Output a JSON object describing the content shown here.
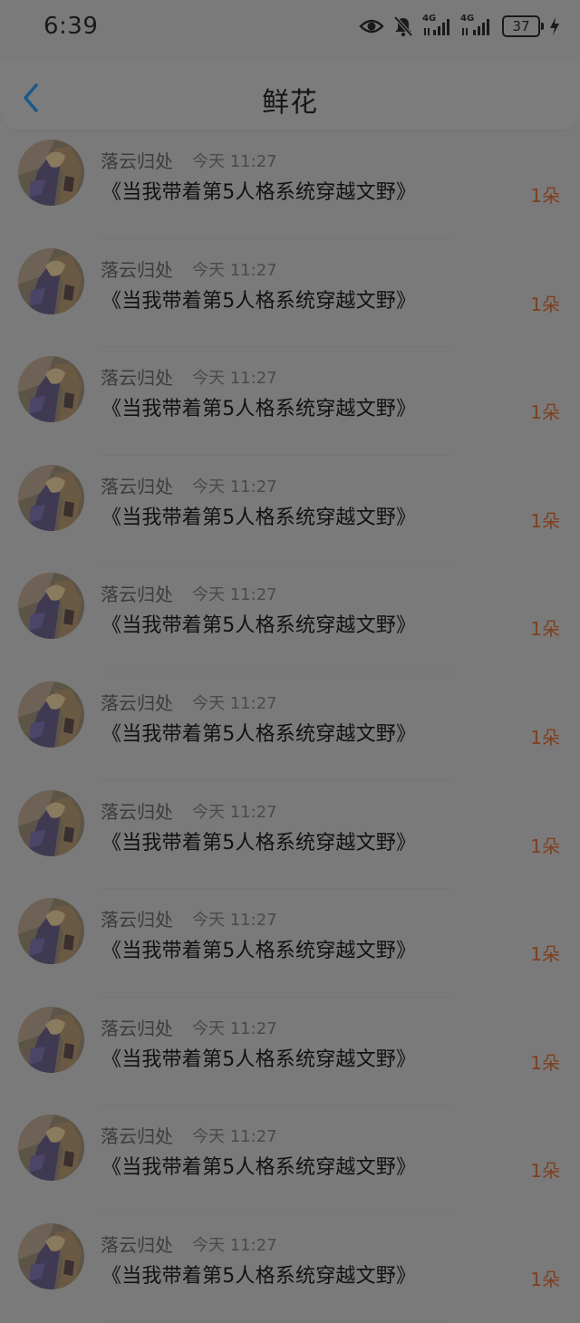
{
  "status_bar": {
    "time": "6:39",
    "network_1": "4G",
    "network_2": "4G",
    "battery_level": "37"
  },
  "header": {
    "title": "鲜花",
    "back_icon": "chevron-left-icon",
    "accent_color": "#1a5a8a"
  },
  "list": [
    {
      "name": "落云归处",
      "time": "今天 11:27",
      "book": "《当我带着第5人格系统穿越文野》",
      "count": "1朵"
    },
    {
      "name": "落云归处",
      "time": "今天 11:27",
      "book": "《当我带着第5人格系统穿越文野》",
      "count": "1朵"
    },
    {
      "name": "落云归处",
      "time": "今天 11:27",
      "book": "《当我带着第5人格系统穿越文野》",
      "count": "1朵"
    },
    {
      "name": "落云归处",
      "time": "今天 11:27",
      "book": "《当我带着第5人格系统穿越文野》",
      "count": "1朵"
    },
    {
      "name": "落云归处",
      "time": "今天 11:27",
      "book": "《当我带着第5人格系统穿越文野》",
      "count": "1朵"
    },
    {
      "name": "落云归处",
      "time": "今天 11:27",
      "book": "《当我带着第5人格系统穿越文野》",
      "count": "1朵"
    },
    {
      "name": "落云归处",
      "time": "今天 11:27",
      "book": "《当我带着第5人格系统穿越文野》",
      "count": "1朵"
    },
    {
      "name": "落云归处",
      "time": "今天 11:27",
      "book": "《当我带着第5人格系统穿越文野》",
      "count": "1朵"
    },
    {
      "name": "落云归处",
      "time": "今天 11:27",
      "book": "《当我带着第5人格系统穿越文野》",
      "count": "1朵"
    },
    {
      "name": "落云归处",
      "time": "今天 11:27",
      "book": "《当我带着第5人格系统穿越文野》",
      "count": "1朵"
    },
    {
      "name": "落云归处",
      "time": "今天 11:27",
      "book": "《当我带着第5人格系统穿越文野》",
      "count": "1朵"
    }
  ]
}
